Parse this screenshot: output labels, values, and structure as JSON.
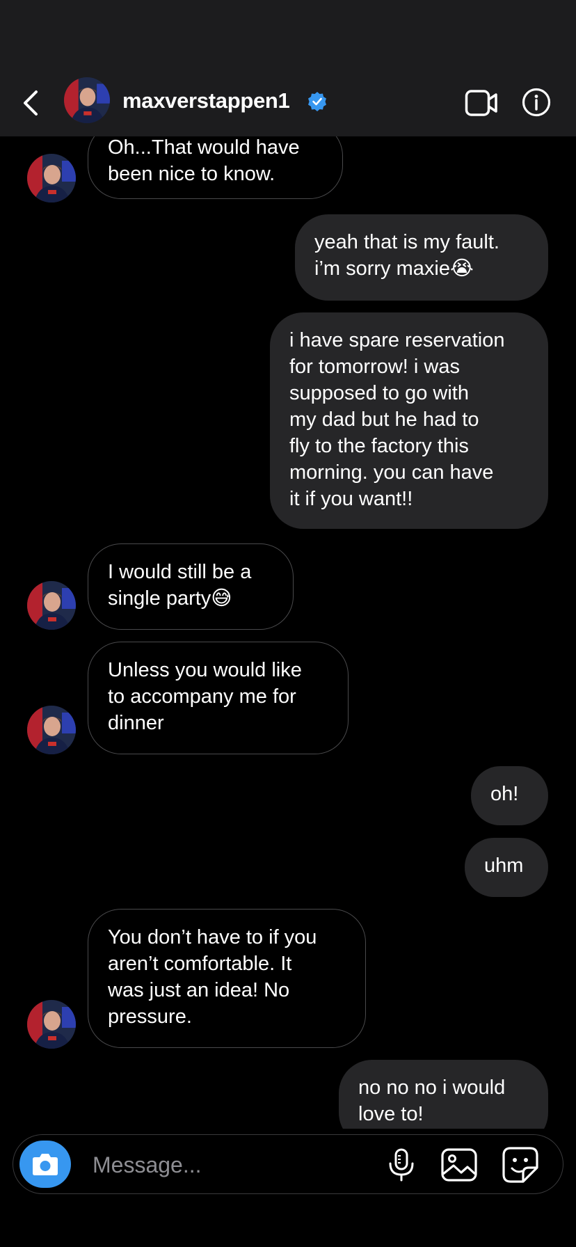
{
  "header": {
    "username": "maxverstappen1"
  },
  "messages": [
    {
      "from": "them",
      "text": "Oh...That would have\nbeen nice to know."
    },
    {
      "from": "me",
      "text": "yeah that is my fault.\ni’m sorry maxie😭"
    },
    {
      "from": "me",
      "text": "i have spare reservation\nfor tomorrow! i was\nsupposed to go with\nmy dad but he had to\nfly to the factory this\nmorning. you can have\nit if you want!!"
    },
    {
      "from": "them",
      "text": "I would still be a\nsingle party😅"
    },
    {
      "from": "them",
      "text": "Unless you would like\nto accompany me for\ndinner"
    },
    {
      "from": "me",
      "text": "oh!"
    },
    {
      "from": "me",
      "text": "uhm"
    },
    {
      "from": "them",
      "text": "You don’t have to if you\naren’t comfortable. It\nwas just an idea! No\npressure."
    },
    {
      "from": "me",
      "text": "no no no i would\nlove to!"
    }
  ],
  "composer": {
    "placeholder": "Message..."
  },
  "colors": {
    "accent": "#3797f0",
    "verified": "#3797f0",
    "outgoing_bubble": "#262628",
    "header_bg": "#1c1c1e"
  },
  "icons": {
    "back": "chevron-left-icon",
    "verified": "verified-badge-icon",
    "video": "video-call-icon",
    "info": "info-icon",
    "camera": "camera-icon",
    "mic": "microphone-icon",
    "gallery": "gallery-icon",
    "sticker": "sticker-icon"
  }
}
